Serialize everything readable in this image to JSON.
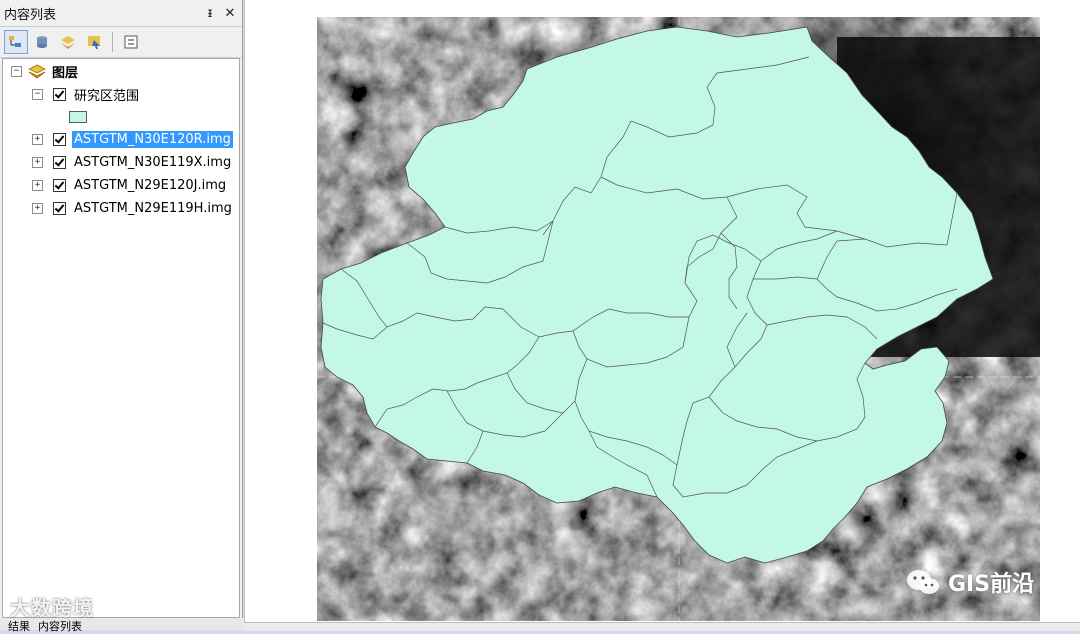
{
  "toc": {
    "title": "内容列表",
    "pin_icon": "pin-icon",
    "close_icon": "close-icon",
    "layers_root": "图层",
    "layers": [
      {
        "name": "研究区范围",
        "expanded": true,
        "checked": true,
        "symbol_color": "#c3f7e6"
      },
      {
        "name": "ASTGTM_N30E120R.img",
        "expanded": false,
        "checked": true,
        "selected": true
      },
      {
        "name": "ASTGTM_N30E119X.img",
        "expanded": false,
        "checked": true
      },
      {
        "name": "ASTGTM_N29E120J.img",
        "expanded": false,
        "checked": true
      },
      {
        "name": "ASTGTM_N29E119H.img",
        "expanded": false,
        "checked": true
      }
    ],
    "bottom_tabs": [
      "结果",
      "内容列表"
    ]
  },
  "watermarks": {
    "left": "大数跨境",
    "right": "GIS前沿"
  },
  "colors": {
    "study_area_fill": "#c3f7e6",
    "selection": "#3399ff"
  }
}
